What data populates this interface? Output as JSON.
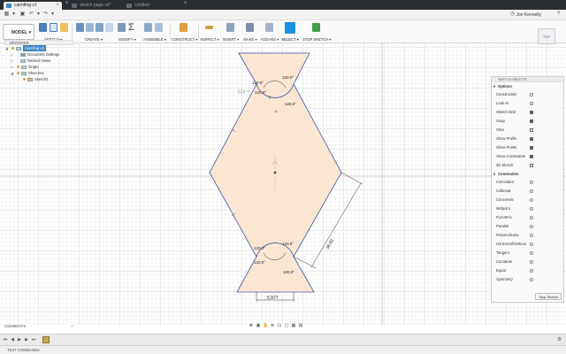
{
  "tabs": [
    {
      "label": "cairnfing v1",
      "active": true
    },
    {
      "label": "sketch page v4*",
      "active": false
    },
    {
      "label": "Untitled",
      "active": false
    }
  ],
  "user": {
    "name": "Jon Kennelly"
  },
  "qat": {
    "file_label": "File",
    "undo_label": "Undo",
    "redo_label": "Redo",
    "save_label": "Save"
  },
  "toolbar": {
    "workspace": "MODEL",
    "groups": [
      {
        "label": "SKETCH ▾"
      },
      {
        "label": "CREATE ▾"
      },
      {
        "label": "MODIFY ▾"
      },
      {
        "label": "ASSEMBLE ▾"
      },
      {
        "label": "CONSTRUCT ▾"
      },
      {
        "label": "INSPECT ▾"
      },
      {
        "label": "INSERT ▾"
      },
      {
        "label": "MAKE ▾"
      },
      {
        "label": "ADD-INS ▾"
      },
      {
        "label": "SELECT ▾"
      },
      {
        "label": "STOP SKETCH ▾"
      }
    ]
  },
  "browser": {
    "title": "BROWSER",
    "items": [
      {
        "label": "cairnfing v1"
      },
      {
        "label": "Document Settings"
      },
      {
        "label": "Named Views"
      },
      {
        "label": "Origin"
      },
      {
        "label": "Sketches"
      },
      {
        "label": "Sketch1"
      }
    ]
  },
  "sketch": {
    "angle_label": "120.0°",
    "dim_bottom": "5.977",
    "dim_side": "39.93"
  },
  "viewcube": {
    "label": "TOP"
  },
  "palette": {
    "title": "SKETCH PALETTE",
    "options_title": "Options",
    "options": [
      {
        "label": "Construction"
      },
      {
        "label": "Look At"
      },
      {
        "label": "Sketch Grid",
        "checked": true
      },
      {
        "label": "Snap",
        "checked": true
      },
      {
        "label": "Slice",
        "checked": false
      },
      {
        "label": "Show Profile",
        "checked": true
      },
      {
        "label": "Show Points",
        "checked": true
      },
      {
        "label": "Show Constraints",
        "checked": true
      },
      {
        "label": "3D Sketch",
        "checked": false
      }
    ],
    "constraints_title": "Constraints",
    "constraints": [
      {
        "label": "Coincident"
      },
      {
        "label": "Collinear"
      },
      {
        "label": "Concentric"
      },
      {
        "label": "Midpoint"
      },
      {
        "label": "Fix/UnFix"
      },
      {
        "label": "Parallel"
      },
      {
        "label": "Perpendicular"
      },
      {
        "label": "Horizontal/Vertical"
      },
      {
        "label": "Tangent"
      },
      {
        "label": "Curvature"
      },
      {
        "label": "Equal"
      },
      {
        "label": "Symmetry"
      }
    ],
    "stop_label": "Stop Sketch"
  },
  "comments": {
    "label": "COMMENTS"
  },
  "text_commands": {
    "label": "TEXT COMMANDS"
  },
  "colors": {
    "profile_fill": "#fbe6d2",
    "sketch_line": "#3a57a8",
    "accent": "#3b86c6",
    "timeline_sketch": "#c9a84b"
  }
}
